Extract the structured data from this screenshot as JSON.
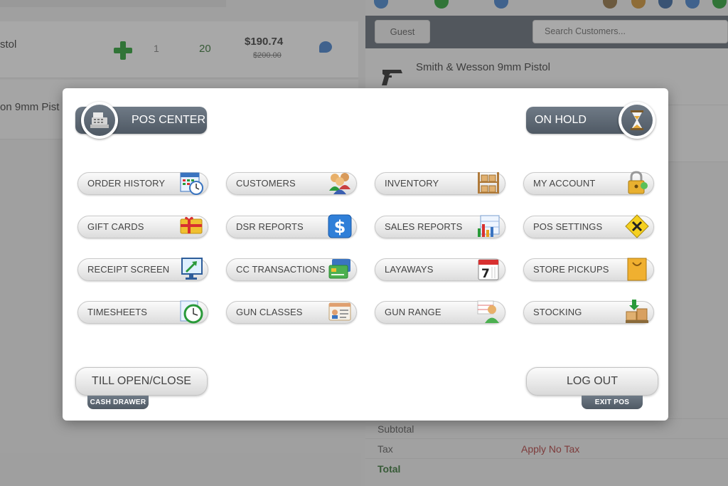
{
  "background": {
    "cart": {
      "rows": [
        {
          "name": "stol",
          "qty": "1",
          "qty2": "20",
          "price": "$190.74",
          "original_price": "$200.00"
        },
        {
          "name": "on 9mm Pist"
        }
      ]
    },
    "customer": {
      "guest_label": "Guest",
      "search_placeholder": "Search Customers..."
    },
    "products": [
      {
        "name": "Smith & Wesson 9mm Pistol"
      }
    ],
    "totals": {
      "subtotal_label": "Subtotal",
      "tax_label": "Tax",
      "tax_value": "Apply No Tax",
      "total_label": "Total"
    }
  },
  "modal": {
    "header": {
      "pos_center_label": "POS CENTER",
      "on_hold_label": "ON HOLD"
    },
    "menu": {
      "order_history": "ORDER HISTORY",
      "customers": "CUSTOMERS",
      "inventory": "INVENTORY",
      "my_account": "MY ACCOUNT",
      "gift_cards": "GIFT CARDS",
      "dsr_reports": "DSR REPORTS",
      "sales_reports": "SALES REPORTS",
      "pos_settings": "POS SETTINGS",
      "receipt_screen": "RECEIPT SCREEN",
      "cc_transactions": "CC TRANSACTIONS",
      "layaways": "LAYAWAYS",
      "store_pickups": "STORE PICKUPS",
      "timesheets": "TIMESHEETS",
      "gun_classes": "GUN CLASSES",
      "gun_range": "GUN RANGE",
      "stocking": "STOCKING"
    },
    "footer": {
      "till_label": "TILL OPEN/CLOSE",
      "till_sub": "CASH DRAWER",
      "logout_label": "LOG OUT",
      "logout_sub": "EXIT POS"
    }
  },
  "icons": {
    "calendar_day": "7"
  },
  "colors": {
    "header_pill": "#5b6570",
    "plus_green": "#1f9a2a",
    "tax_value": "#a33333",
    "total_green": "#2a6b2a"
  }
}
